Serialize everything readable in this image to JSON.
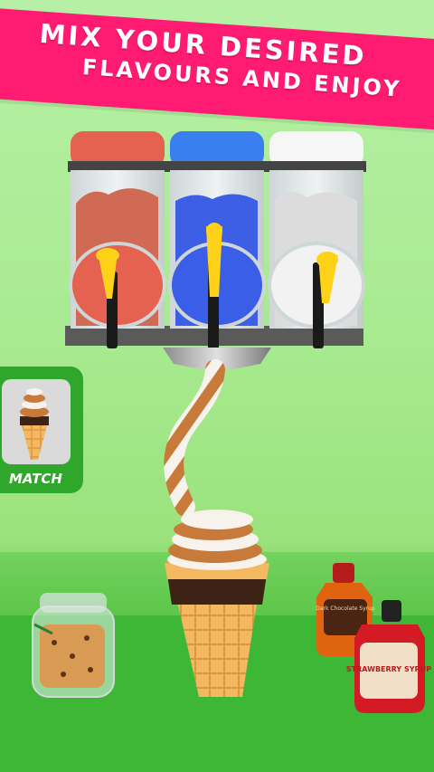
{
  "banner": {
    "line1": "MIX YOUR DESIRED",
    "line2": "FLAVOURS AND ENJOY"
  },
  "match": {
    "label": "MATCH"
  },
  "machine": {
    "tanks": [
      {
        "flavor": "strawberry",
        "color": "#e4624f"
      },
      {
        "flavor": "blueberry",
        "color": "#3a5ee8"
      },
      {
        "flavor": "vanilla",
        "color": "#e9e9e9"
      }
    ]
  },
  "props": {
    "chocolate_bottle_text": "Dark Chocolate Syrup",
    "strawberry_bottle_text": "STRAWBERRY SYRUP"
  },
  "colors": {
    "banner": "#ff1a72",
    "match_card": "#2ea72a",
    "cone": "#f3b860",
    "swirl_brown": "#c87a3a",
    "swirl_white": "#f7f3ec",
    "handle": "#ffd21a"
  }
}
